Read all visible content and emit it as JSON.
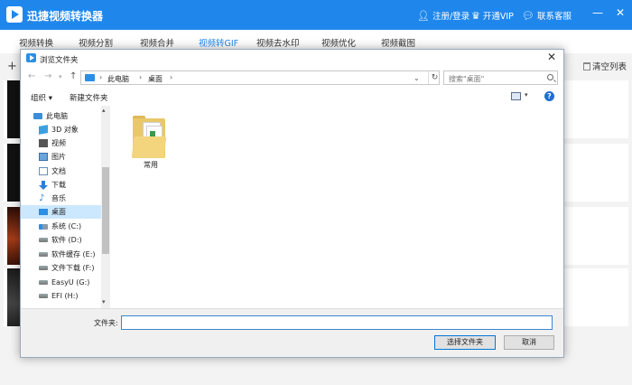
{
  "app": {
    "title": "迅捷视频转换器",
    "titlebar": {
      "login_label": "注册/登录",
      "vip_label": "开通VIP",
      "service_label": "联系客服",
      "minimize": "—",
      "close": "✕"
    },
    "tabs": [
      {
        "label": "视频转换"
      },
      {
        "label": "视频分割"
      },
      {
        "label": "视频合并"
      },
      {
        "label": "视频转GIF"
      },
      {
        "label": "视频去水印"
      },
      {
        "label": "视频优化"
      },
      {
        "label": "视频截图"
      }
    ],
    "active_tab": 3,
    "toolbar": {
      "add_symbol": "+",
      "clear_label": "清空列表"
    },
    "accent_color": "#1f87ec"
  },
  "dialog": {
    "title": "浏览文件夹",
    "close": "✕",
    "address": {
      "segments": [
        "此电脑",
        "桌面"
      ]
    },
    "search_placeholder": "搜索\"桌面\"",
    "commands": {
      "organize": "组织 ▾",
      "new_folder": "新建文件夹"
    },
    "help": "?",
    "tree": [
      {
        "label": "此电脑",
        "icon": "pc"
      },
      {
        "label": "3D 对象",
        "icon": "cube"
      },
      {
        "label": "视频",
        "icon": "video"
      },
      {
        "label": "图片",
        "icon": "pic"
      },
      {
        "label": "文档",
        "icon": "doc"
      },
      {
        "label": "下载",
        "icon": "down"
      },
      {
        "label": "音乐",
        "icon": "music"
      },
      {
        "label": "桌面",
        "icon": "desk",
        "selected": true
      },
      {
        "label": "系统 (C:)",
        "icon": "drive-sys"
      },
      {
        "label": "软件 (D:)",
        "icon": "drive"
      },
      {
        "label": "软件缓存 (E:)",
        "icon": "drive"
      },
      {
        "label": "文件下载 (F:)",
        "icon": "drive"
      },
      {
        "label": "EasyU (G:)",
        "icon": "drive"
      },
      {
        "label": "EFI (H:)",
        "icon": "drive"
      }
    ],
    "files": [
      {
        "name": "常用",
        "icon": "folder"
      }
    ],
    "folder_field": {
      "label": "文件夹:",
      "value": ""
    },
    "buttons": {
      "select": "选择文件夹",
      "cancel": "取消"
    }
  }
}
